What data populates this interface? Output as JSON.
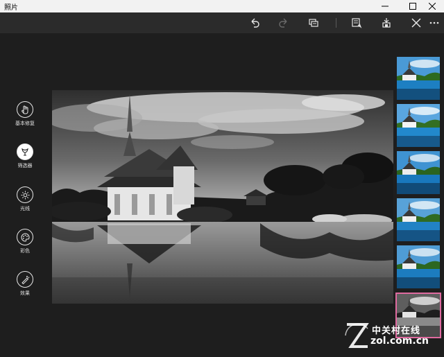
{
  "window": {
    "title": "照片"
  },
  "toolbar": {
    "buttons": [
      {
        "name": "undo",
        "icon": "undo-icon",
        "enabled": true
      },
      {
        "name": "redo",
        "icon": "redo-icon",
        "enabled": false
      },
      {
        "name": "compare",
        "icon": "compare-icon",
        "enabled": true
      },
      {
        "name": "save-copy",
        "icon": "save-copy-icon",
        "enabled": true
      },
      {
        "name": "save",
        "icon": "save-icon",
        "enabled": true
      },
      {
        "name": "close",
        "icon": "close-icon",
        "enabled": true
      },
      {
        "name": "more",
        "icon": "more-icon",
        "enabled": true
      }
    ]
  },
  "sidebar": {
    "items": [
      {
        "label": "基本修复",
        "icon": "hand-icon",
        "active": false
      },
      {
        "label": "筛选器",
        "icon": "filter-icon",
        "active": true
      },
      {
        "label": "光线",
        "icon": "sun-icon",
        "active": false
      },
      {
        "label": "彩色",
        "icon": "palette-icon",
        "active": false
      },
      {
        "label": "效果",
        "icon": "effects-icon",
        "active": false
      }
    ]
  },
  "filters": {
    "selected_index": 5,
    "count": 6
  },
  "watermark": {
    "text_cn": "中关村在线",
    "text_en": "zol.com.cn"
  },
  "colors": {
    "background": "#1e1e1e",
    "toolbar": "#2b2b2b",
    "titlebar": "#f2f2f2",
    "selection": "#e06aa0"
  }
}
